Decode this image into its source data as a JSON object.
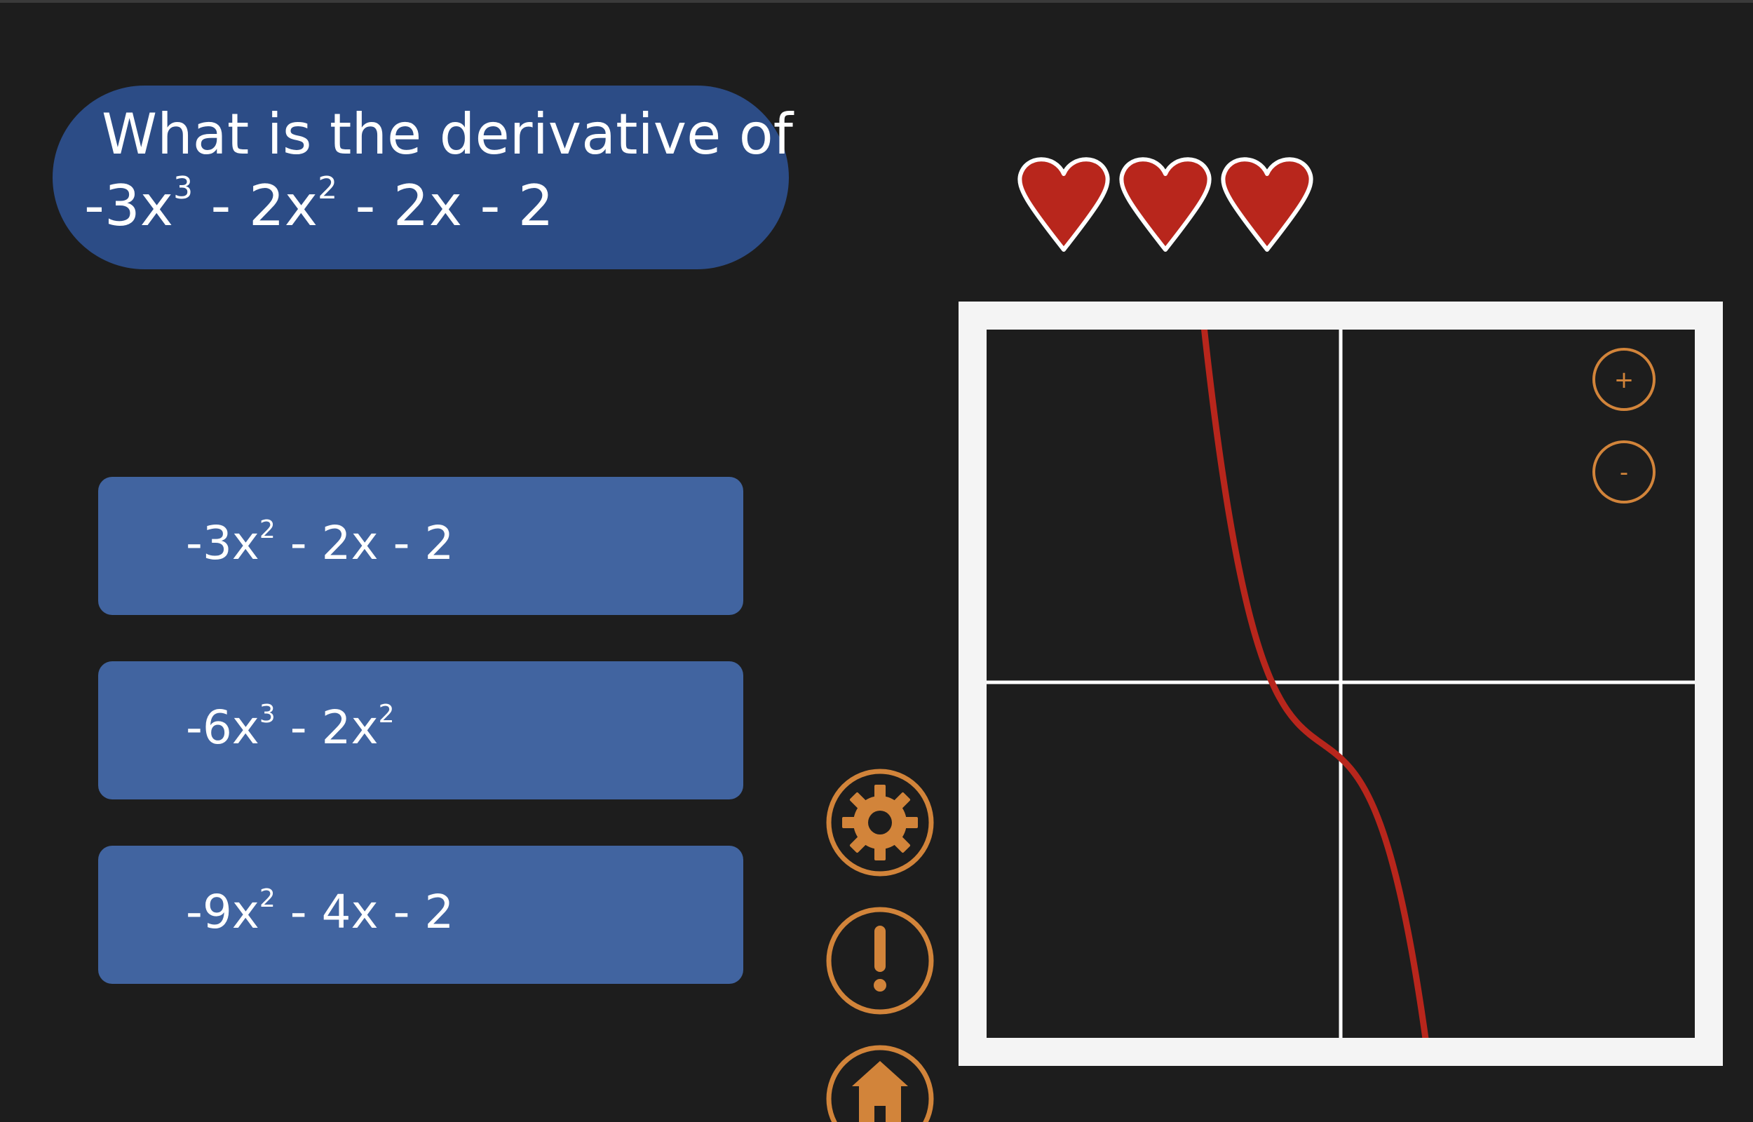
{
  "question": {
    "prompt": "What is the derivative of",
    "terms": [
      {
        "coef": "-3x",
        "exp": "3"
      },
      {
        "coef": " - 2x",
        "exp": "2"
      },
      {
        "coef": " - 2x  -  2",
        "exp": ""
      }
    ]
  },
  "answers": [
    {
      "terms": [
        {
          "coef": "-3x",
          "exp": "2"
        },
        {
          "coef": " - 2x  -  2",
          "exp": ""
        }
      ]
    },
    {
      "terms": [
        {
          "coef": "-6x",
          "exp": "3"
        },
        {
          "coef": " - 2x",
          "exp": "2"
        }
      ]
    },
    {
      "terms": [
        {
          "coef": "-9x",
          "exp": "2"
        },
        {
          "coef": " - 4x  -  2",
          "exp": ""
        }
      ]
    }
  ],
  "lives": 3,
  "graph": {
    "function": "-3x^3 - 2x^2 - 2x - 2",
    "curve_color": "#b8261c",
    "zoom_in_label": "+",
    "zoom_out_label": "-"
  },
  "colors": {
    "background": "#1d1d1d",
    "question_bg": "#2c4c86",
    "answer_bg": "#4164a0",
    "accent": "#d2843a",
    "heart": "#b8261c"
  },
  "icons": {
    "settings": "gear-icon",
    "hint": "exclamation-icon",
    "home": "home-icon"
  }
}
